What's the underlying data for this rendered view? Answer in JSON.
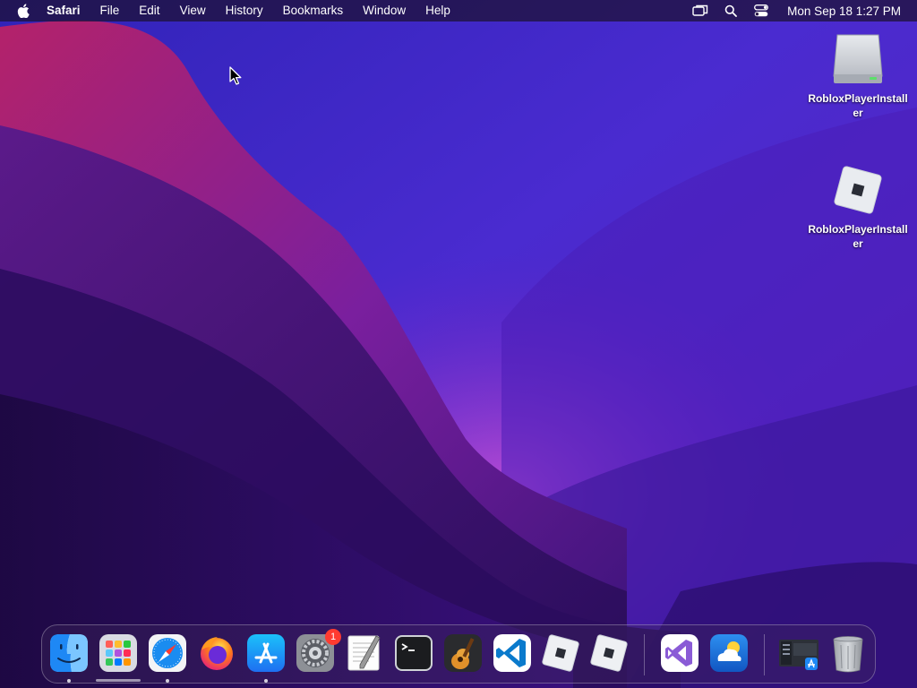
{
  "menubar": {
    "app_name": "Safari",
    "menus": [
      "File",
      "Edit",
      "View",
      "History",
      "Bookmarks",
      "Window",
      "Help"
    ],
    "status_icons": [
      "screen-mirroring-icon",
      "search-icon",
      "control-center-icon"
    ],
    "clock": "Mon Sep 18  1:27 PM"
  },
  "desktop": {
    "icons": [
      {
        "label": "RobloxPlayerInstaller",
        "icon": "disk-image-icon"
      },
      {
        "label": "RobloxPlayerInstaller",
        "icon": "roblox-icon"
      }
    ]
  },
  "dock": {
    "apps": [
      {
        "name": "Finder",
        "icon": "finder-icon",
        "running": true
      },
      {
        "name": "Launchpad",
        "icon": "launchpad-icon",
        "running": false
      },
      {
        "name": "Safari",
        "icon": "safari-icon",
        "running": true
      },
      {
        "name": "Firefox",
        "icon": "firefox-icon",
        "running": false
      },
      {
        "name": "App Store",
        "icon": "app-store-icon",
        "running": true
      },
      {
        "name": "System Preferences",
        "icon": "system-preferences-icon",
        "running": false,
        "badge": "1"
      },
      {
        "name": "TextEdit",
        "icon": "textedit-icon",
        "running": false
      },
      {
        "name": "Terminal",
        "icon": "terminal-icon",
        "running": false
      },
      {
        "name": "GarageBand",
        "icon": "garageband-icon",
        "running": false
      },
      {
        "name": "Visual Studio Code",
        "icon": "vscode-icon",
        "running": false
      },
      {
        "name": "Roblox",
        "icon": "roblox-icon",
        "running": false
      },
      {
        "name": "Roblox Studio",
        "icon": "roblox-studio-icon",
        "running": false
      },
      {
        "name": "Visual Studio",
        "icon": "visual-studio-icon",
        "running": false
      },
      {
        "name": "Weather",
        "icon": "weather-icon",
        "running": false
      },
      {
        "name": "Downloads",
        "icon": "downloads-stack-icon",
        "running": false
      },
      {
        "name": "Trash",
        "icon": "trash-icon",
        "running": false
      }
    ]
  },
  "colors": {
    "wallpaper_top": "#3a2fc9",
    "wallpaper_mid": "#5b1aa8",
    "wallpaper_dark": "#1f0a4d",
    "wallpaper_red": "#c0266b",
    "badge": "#ff3b30"
  }
}
